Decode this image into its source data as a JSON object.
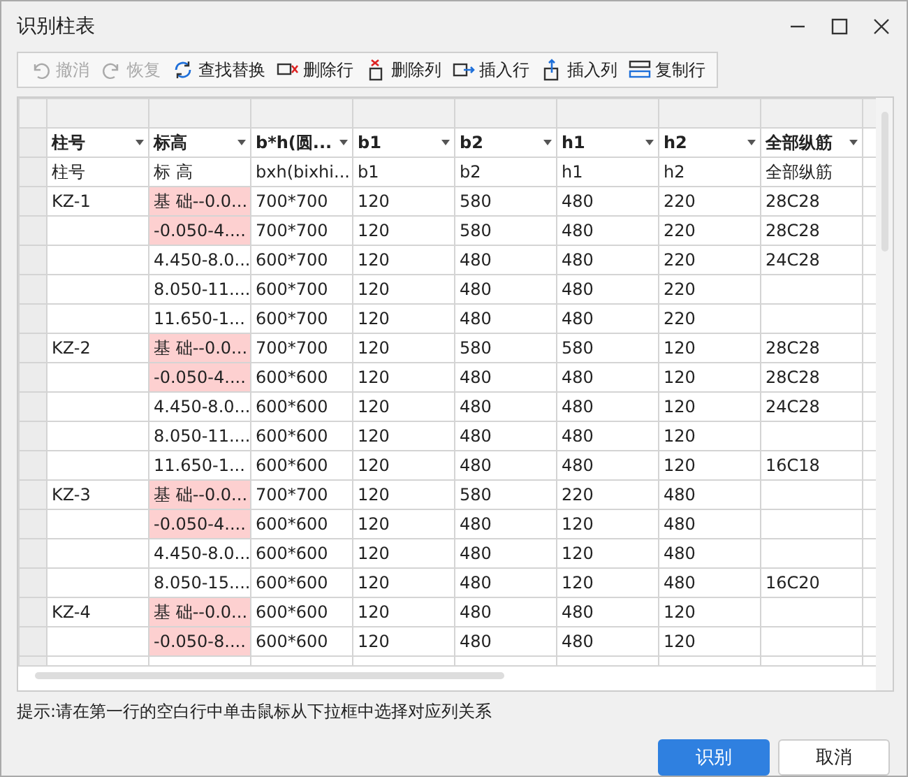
{
  "window": {
    "title": "识别柱表"
  },
  "toolbar": [
    {
      "label": "撤消",
      "disabled": true
    },
    {
      "label": "恢复",
      "disabled": true
    },
    {
      "label": "查找替换",
      "disabled": false
    },
    {
      "label": "删除行",
      "disabled": false
    },
    {
      "label": "删除列",
      "disabled": false
    },
    {
      "label": "插入行",
      "disabled": false
    },
    {
      "label": "插入列",
      "disabled": false
    },
    {
      "label": "复制行",
      "disabled": false
    }
  ],
  "table": {
    "columns": [
      "柱号",
      "标高",
      "b*h(圆...",
      "b1",
      "b2",
      "h1",
      "h2",
      "全部纵筋"
    ],
    "mapping": [
      "柱号",
      "标 高",
      "bxh(bixhi...",
      "b1",
      "b2",
      "h1",
      "h2",
      "全部纵筋"
    ],
    "rows": [
      {
        "flagged": true,
        "cells": [
          "KZ-1",
          "基 础--0.0...",
          "700*700",
          "120",
          "580",
          "480",
          "220",
          "28C28"
        ]
      },
      {
        "flagged": true,
        "cells": [
          null,
          "-0.050-4....",
          "700*700",
          "120",
          "580",
          "480",
          "220",
          "28C28"
        ]
      },
      {
        "flagged": false,
        "cells": [
          null,
          "4.450-8.0...",
          "600*700",
          "120",
          "480",
          "480",
          "220",
          "24C28"
        ]
      },
      {
        "flagged": false,
        "cells": [
          null,
          "8.050-11....",
          "600*700",
          "120",
          "480",
          "480",
          "220",
          null
        ]
      },
      {
        "flagged": false,
        "cells": [
          null,
          "11.650-1...",
          "600*700",
          "120",
          "480",
          "480",
          "220",
          null
        ]
      },
      {
        "flagged": true,
        "cells": [
          "KZ-2",
          "基 础--0.0...",
          "700*700",
          "120",
          "580",
          "580",
          "120",
          "28C28"
        ]
      },
      {
        "flagged": true,
        "cells": [
          null,
          "-0.050-4....",
          "600*600",
          "120",
          "480",
          "480",
          "120",
          "28C28"
        ]
      },
      {
        "flagged": false,
        "cells": [
          null,
          "4.450-8.0...",
          "600*600",
          "120",
          "480",
          "480",
          "120",
          "24C28"
        ]
      },
      {
        "flagged": false,
        "cells": [
          null,
          "8.050-11....",
          "600*600",
          "120",
          "480",
          "480",
          "120",
          null
        ]
      },
      {
        "flagged": false,
        "cells": [
          null,
          "11.650-1...",
          "600*600",
          "120",
          "480",
          "480",
          "120",
          "16C18"
        ]
      },
      {
        "flagged": true,
        "cells": [
          "KZ-3",
          "基 础--0.0...",
          "700*700",
          "120",
          "580",
          "220",
          "480",
          null
        ]
      },
      {
        "flagged": true,
        "cells": [
          null,
          "-0.050-4....",
          "600*600",
          "120",
          "480",
          "120",
          "480",
          null
        ]
      },
      {
        "flagged": false,
        "cells": [
          null,
          "4.450-8.0...",
          "600*600",
          "120",
          "480",
          "120",
          "480",
          null
        ]
      },
      {
        "flagged": false,
        "cells": [
          null,
          "8.050-15....",
          "600*600",
          "120",
          "480",
          "120",
          "480",
          "16C20"
        ]
      },
      {
        "flagged": true,
        "cells": [
          "KZ-4",
          "基 础--0.0...",
          "600*600",
          "120",
          "480",
          "480",
          "120",
          null
        ]
      },
      {
        "flagged": true,
        "cells": [
          null,
          "-0.050-8....",
          "600*600",
          "120",
          "480",
          "480",
          "120",
          null
        ]
      }
    ]
  },
  "hint": "提示:请在第一行的空白行中单击鼠标从下拉框中选择对应列关系",
  "buttons": [
    {
      "label": "识别",
      "kind": "primary"
    },
    {
      "label": "取消",
      "kind": "secondary"
    }
  ]
}
